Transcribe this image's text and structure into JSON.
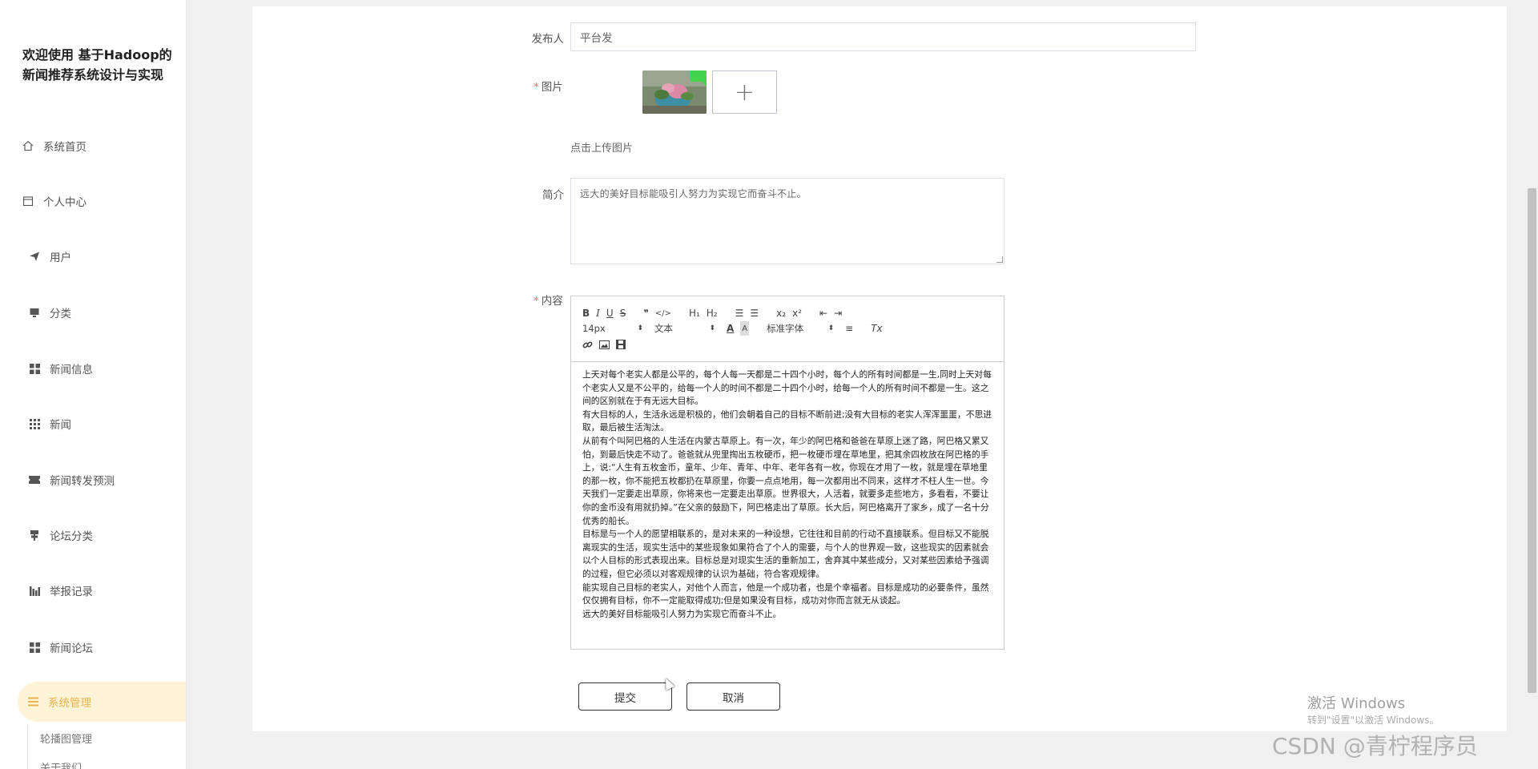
{
  "sidebar": {
    "title": "欢迎使用 基于Hadoop的新闻推荐系统设计与实现",
    "items": [
      {
        "label": "系统首页",
        "icon": "home-icon"
      },
      {
        "label": "个人中心",
        "icon": "calendar-icon"
      },
      {
        "label": "用户",
        "icon": "send-icon"
      },
      {
        "label": "分类",
        "icon": "monitor-icon"
      },
      {
        "label": "新闻信息",
        "icon": "grid-icon"
      },
      {
        "label": "新闻",
        "icon": "dots-grid-icon"
      },
      {
        "label": "新闻转发预测",
        "icon": "ticket-icon"
      },
      {
        "label": "论坛分类",
        "icon": "signpost-icon"
      },
      {
        "label": "举报记录",
        "icon": "bar-chart-icon"
      },
      {
        "label": "新闻论坛",
        "icon": "grid-icon"
      },
      {
        "label": "系统管理",
        "icon": "list-icon"
      }
    ],
    "sub_items": [
      "轮播图管理",
      "关于我们"
    ]
  },
  "form": {
    "publisher_label": "发布人",
    "publisher_value": "平台发",
    "image_label": "图片",
    "upload_hint": "点击上传图片",
    "upload_plus": "+",
    "intro_label": "简介",
    "intro_value": "远大的美好目标能吸引人努力为实现它而奋斗不止。",
    "content_label": "内容",
    "required_mark": "*"
  },
  "editor": {
    "toolbar": {
      "bold": "B",
      "italic": "I",
      "underline": "U",
      "strike": "S",
      "quote": "❞",
      "code": "</>",
      "h1": "H₁",
      "h2": "H₂",
      "ol": "☰",
      "ul": "☰",
      "sub": "x₂",
      "sup": "x²",
      "indent_out": "⇤",
      "indent_in": "⇥",
      "size": "14px",
      "font": "文本",
      "color": "A",
      "bg": "A",
      "family": "标准字体",
      "align": "≡",
      "clean": "Tx",
      "link": "🔗",
      "image": "▣",
      "video": "▤"
    },
    "paragraphs": [
      "  上天对每个老实人都是公平的，每个人每一天都是二十四个小时，每个人的所有时间都是一生,同时上天对每个老实人又是不公平的，给每一个人的时间不都是二十四个小时，给每一个人的所有时间不都是一生。这之间的区别就在于有无远大目标。",
      "   有大目标的人，生活永远是积极的，他们会朝着自己的目标不断前进;没有大目标的老实人浑浑噩噩，不思进取，最后被生活淘汰。",
      " 从前有个叫阿巴格的人生活在内蒙古草原上。有一次，年少的阿巴格和爸爸在草原上迷了路，阿巴格又累又怕，到最后快走不动了。爸爸就从兜里掏出五枚硬币，把一枚硬币埋在草地里，把其余四枚放在阿巴格的手上，说:“人生有五枚金币，童年、少年、青年、中年、老年各有一枚，你现在才用了一枚，就是埋在草地里的那一枚，你不能把五枚都扔在草原里，你要一点点地用，每一次都用出不同来，这样才不枉人生一世。今天我们一定要走出草原，你将来也一定要走出草原。世界很大，人活着，就要多走些地方，多看看，不要让你的金币没有用就扔掉。”在父亲的鼓励下，阿巴格走出了草原。长大后，阿巴格离开了家乡，成了一名十分优秀的船长。",
      " 目标是与一个人的愿望相联系的，是对未来的一种设想，它往往和目前的行动不直接联系。但目标又不能脱离现实的生活，现实生活中的某些现象如果符合了个人的需要，与个人的世界观一致，这些现实的因素就会以个人目标的形式表现出来。目标总是对现实生活的重新加工，舍弃其中某些成分，又对某些因素给予强调的过程，但它必须以对客观规律的认识为基础，符合客观规律。",
      " 能实现自己目标的老实人，对他个人而言，他是一个成功者，也是个幸福者。目标是成功的必要条件，虽然仅仅拥有目标，你不一定能取得成功;但是如果没有目标，成功对你而言就无从谈起。",
      "远大的美好目标能吸引人努力为实现它而奋斗不止。"
    ]
  },
  "buttons": {
    "submit": "提交",
    "cancel": "取消"
  },
  "watermarks": {
    "activate": "激活 Windows",
    "activate_sub": "转到\"设置\"以激活 Windows。",
    "csdn": "CSDN @青柠程序员"
  },
  "colors": {
    "accent": "#e9b44c",
    "accent_bg": "#fdf3d6",
    "required": "#f56c6c"
  }
}
